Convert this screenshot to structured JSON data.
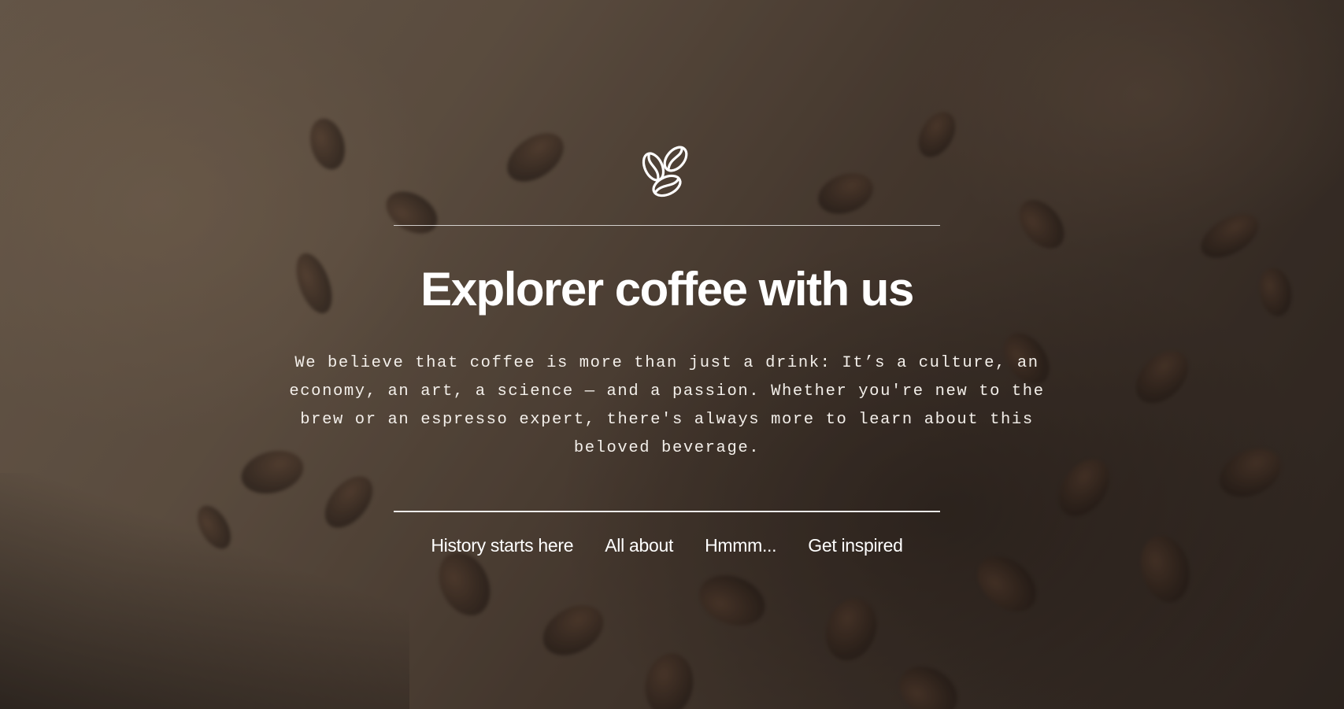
{
  "hero": {
    "logo_icon": "coffee-beans-icon",
    "title": "Explorer coffee with us",
    "intro": "We believe that coffee is more than just a drink: It’s a culture, an economy, an art, a science — and a passion. Whether you're new to the brew or an espresso expert, there's always more to learn about this beloved beverage."
  },
  "nav": {
    "items": [
      {
        "label": "History starts here"
      },
      {
        "label": "All about"
      },
      {
        "label": "Hmmm..."
      },
      {
        "label": "Get inspired"
      }
    ]
  },
  "colors": {
    "text": "#ffffff",
    "background_dark": "#3a2f27",
    "background_light": "#7b6a58"
  }
}
